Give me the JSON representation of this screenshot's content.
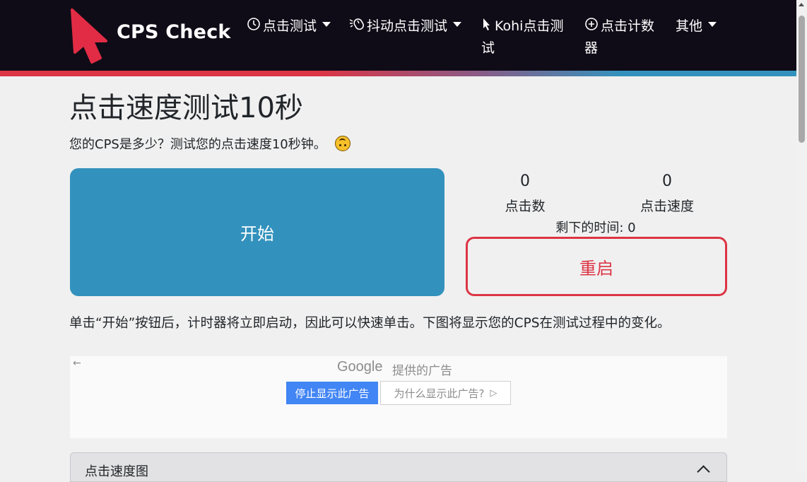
{
  "nav": {
    "brand": "CPS Check",
    "items": [
      {
        "icon": "clock-icon",
        "label": "点击测试",
        "dropdown": true
      },
      {
        "icon": "mouse-jitter-icon",
        "label": "抖动点击测试",
        "dropdown": true
      },
      {
        "icon": "cursor-icon",
        "label_line1": "Kohi点击测",
        "label_line2": "试",
        "dropdown": false
      },
      {
        "icon": "plus-circle-icon",
        "label_line1": "点击计数",
        "label_line2": "器",
        "dropdown": false
      },
      {
        "icon": "",
        "label": "其他",
        "dropdown": true
      }
    ]
  },
  "main": {
    "title": "点击速度测试10秒",
    "subtitle": "您的CPS是多少？测试您的点击速度10秒钟。",
    "start_label": "开始",
    "clicks_value": "0",
    "clicks_label": "点击数",
    "speed_value": "0",
    "speed_label": "点击速度",
    "time_left": "剩下的时间: 0",
    "restart_label": "重启",
    "description": "单击“开始”按钮后，计时器将立即启动，因此可以快速单击。下图将显示您的CPS在测试过程中的变化。"
  },
  "ad": {
    "back_arrow": "←",
    "google": "Google",
    "provided_by": "提供的广告",
    "stop_label": "停止显示此广告",
    "why_label": "为什么显示此广告?",
    "why_icon": "▷"
  },
  "accordion": {
    "label": "点击速度图"
  },
  "colors": {
    "navbar_bg": "#0f0c17",
    "start_button": "#3392bd",
    "restart_button": "#dc3545",
    "brand_red": "#e22c45"
  }
}
